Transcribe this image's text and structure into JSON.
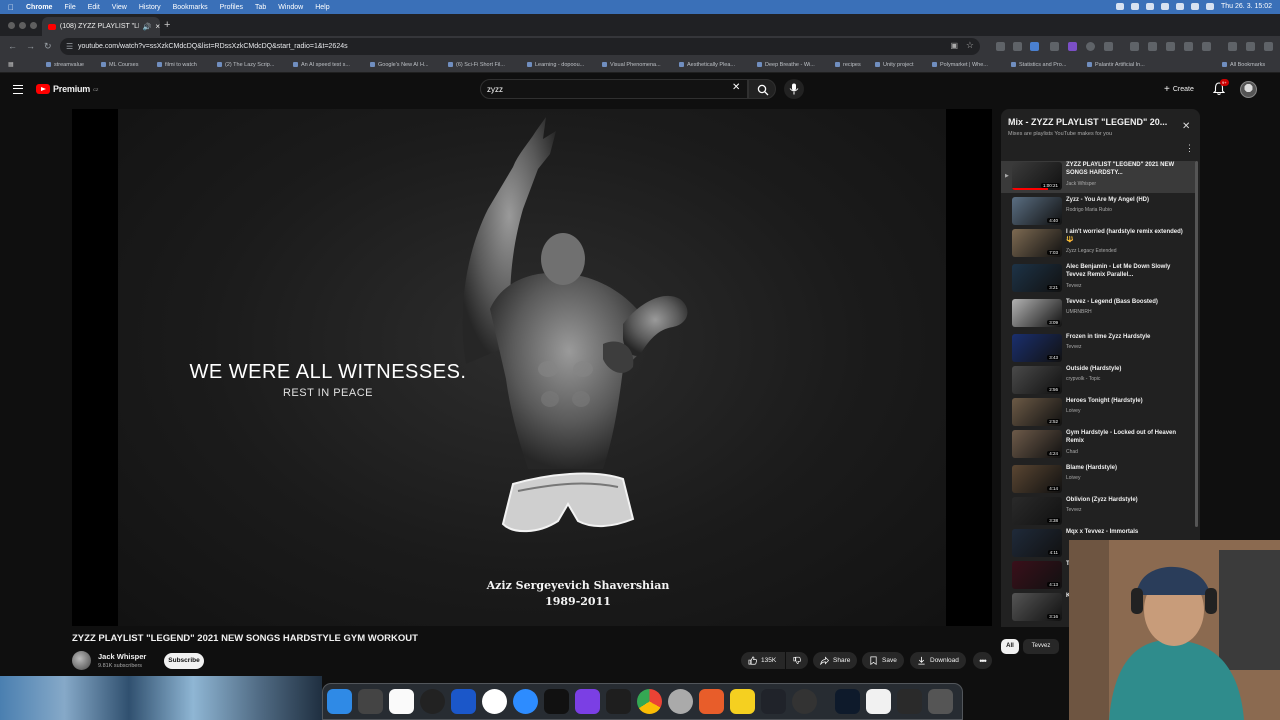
{
  "menubar": {
    "app": "Chrome",
    "items": [
      "File",
      "Edit",
      "View",
      "History",
      "Bookmarks",
      "Profiles",
      "Tab",
      "Window",
      "Help"
    ],
    "datetime": "Thu 26. 3.  15:02"
  },
  "browser": {
    "tab_title": "(108) ZYZZ PLAYLIST \"LE",
    "url": "youtube.com/watch?v=ssXzkCMdcDQ&list=RDssXzkCMdcDQ&start_radio=1&t=2624s",
    "bookmarks": [
      "streamvalue",
      "ML Courses",
      "filmi to watch",
      "(2) The Lazy Scrip...",
      "An AI speed test s...",
      "Google's New AI H...",
      "(6) Sci-Fi Short Fil...",
      "Learning - dopoou...",
      "Visual Phenomena...",
      "Aesthetically Plea...",
      "Deep Breathe - Wi...",
      "recipes",
      "Unity project",
      "Polymarket | Whe...",
      "Statistics and Pro...",
      "Palantir Artificial In..."
    ],
    "all_bookmarks": "All Bookmarks"
  },
  "youtube": {
    "logo_text": "Premium",
    "logo_country": "CZ",
    "search_value": "zyzz",
    "create_label": "Create",
    "notif_count": "9+"
  },
  "video": {
    "overlay_line1": "WE WERE ALL WITNESSES.",
    "overlay_line2": "REST IN PEACE",
    "caption_name": "Aziz Sergeyevich Shavershian",
    "caption_years": "1989-2011",
    "title": "ZYZZ PLAYLIST \"LEGEND\" 2021 NEW SONGS HARDSTYLE GYM WORKOUT",
    "channel": "Jack Whisper",
    "subscribers": "9.81K subscribers",
    "subscribe_label": "Subscribe",
    "likes": "135K",
    "share_label": "Share",
    "save_label": "Save",
    "download_label": "Download"
  },
  "playlist": {
    "title": "Mix - ZYZZ PLAYLIST \"LEGEND\" 20...",
    "subtitle": "Mixes are playlists YouTube makes for you",
    "items": [
      {
        "title": "ZYZZ PLAYLIST \"LEGEND\" 2021 NEW SONGS HARDSTY...",
        "channel": "Jack Whisper",
        "duration": "1:00:21",
        "thumb": "#3b3b3b"
      },
      {
        "title": "Zyzz - You Are My Angel (HD)",
        "channel": "Rodrigo Maria Rubio",
        "duration": "4:40",
        "thumb": "#5a6e82"
      },
      {
        "title": "I ain't worried (hardstyle remix extended)🔱",
        "channel": "Zyzz Legacy Extended",
        "duration": "7:03",
        "thumb": "#7d6a52"
      },
      {
        "title": "Alec Benjamin - Let Me Down Slowly Tevvez Remix Parallel...",
        "channel": "Tevvez",
        "duration": "3:21",
        "thumb": "#1d3347"
      },
      {
        "title": "Tevvez - Legend (Bass Boosted)",
        "channel": "UMRNBRH",
        "duration": "3:09",
        "thumb": "#b3b3b3"
      },
      {
        "title": "Frozen in time Zyzz Hardstyle",
        "channel": "Tevvez",
        "duration": "3:43",
        "thumb": "#1a2f6e"
      },
      {
        "title": "Outside (Hardstyle)",
        "channel": "crypvolk - Topic",
        "duration": "2:56",
        "thumb": "#4a4a4a"
      },
      {
        "title": "Heroes Tonight (Hardstyle)",
        "channel": "Loivey",
        "duration": "2:52",
        "thumb": "#6c5a46"
      },
      {
        "title": "Gym Hardstyle - Locked out of Heaven Remix",
        "channel": "Chad",
        "duration": "4:24",
        "thumb": "#6d5a49"
      },
      {
        "title": "Blame (Hardstyle)",
        "channel": "Loivey",
        "duration": "4:14",
        "thumb": "#5a4632"
      },
      {
        "title": "Oblivion (Zyzz Hardstyle)",
        "channel": "Tevvez",
        "duration": "3:38",
        "thumb": "#2a2a2a"
      },
      {
        "title": "Mqx x Tevvez - Immortals",
        "channel": "",
        "duration": "4:11",
        "thumb": "#1f2a3a"
      },
      {
        "title": "T",
        "channel": "",
        "duration": "4:13",
        "thumb": "#3a0f1a"
      },
      {
        "title": "K",
        "channel": "",
        "duration": "3:16",
        "thumb": "#555555"
      }
    ]
  },
  "chips": {
    "all": "All",
    "tevvez": "Tevvez"
  },
  "colors": {
    "yt_red": "#ff0000",
    "bg": "#0f0f0f",
    "panel": "#212121",
    "menubar": "#3a70b8"
  }
}
